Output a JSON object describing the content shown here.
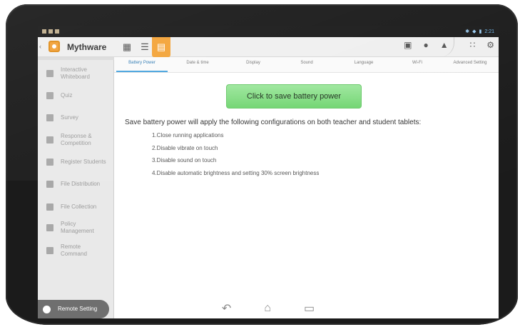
{
  "statusbar": {
    "time": "2:21"
  },
  "topbar": {
    "app_name": "Mythware"
  },
  "sidebar": {
    "items": [
      {
        "label": "Interactive Whiteboard",
        "icon": "whiteboard-icon"
      },
      {
        "label": "Quiz",
        "icon": "quiz-icon"
      },
      {
        "label": "Survey",
        "icon": "survey-icon"
      },
      {
        "label": "Response & Competition",
        "icon": "response-icon"
      },
      {
        "label": "Register Students",
        "icon": "register-icon"
      },
      {
        "label": "File Distribution",
        "icon": "file-distribution-icon"
      },
      {
        "label": "File Collection",
        "icon": "file-collection-icon"
      },
      {
        "label": "Policy Management",
        "icon": "policy-icon"
      },
      {
        "label": "Remote Command",
        "icon": "remote-command-icon"
      },
      {
        "label": "Remote Setting",
        "icon": "remote-setting-icon"
      }
    ]
  },
  "tabs": [
    {
      "label": "Battery Power"
    },
    {
      "label": "Date & time"
    },
    {
      "label": "Display"
    },
    {
      "label": "Sound"
    },
    {
      "label": "Language"
    },
    {
      "label": "Wi-Fi"
    },
    {
      "label": "Advanced Setting"
    }
  ],
  "main": {
    "save_button": "Click to save battery power",
    "intro": "Save battery power will apply the following configurations on both teacher and student tablets:",
    "configs": [
      "1.Close running applications",
      "2.Disable vibrate on touch",
      "3.Disable sound on touch",
      "4.Disable automatic brightness and setting 30% screen brightness"
    ]
  },
  "colors": {
    "accent": "#f3a43a",
    "save_button": "#7ddc7d",
    "tab_active": "#48a4df",
    "sidebar_active": "#6f6f6f"
  }
}
